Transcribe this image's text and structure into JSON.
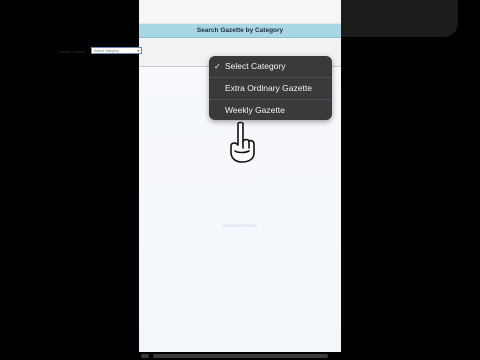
{
  "page": {
    "title": "Search Gazette by Category",
    "filter_label": "Gazette Category",
    "select_value": "Select Category",
    "empty_text": "NOTHING FOUND"
  },
  "dropdown": {
    "options": [
      {
        "label": "Select Category",
        "selected": true
      },
      {
        "label": "Extra Ordinary Gazette",
        "selected": false
      },
      {
        "label": "Weekly Gazette",
        "selected": false
      }
    ]
  },
  "icons": {
    "check": "checkmark-icon",
    "hand": "pointing-hand-icon",
    "chevron": "chevron-down-icon"
  },
  "colors": {
    "title_bar": "#a9d6e3",
    "dropdown_bg": "#3a3a3c",
    "select_border": "#6b89b3"
  }
}
